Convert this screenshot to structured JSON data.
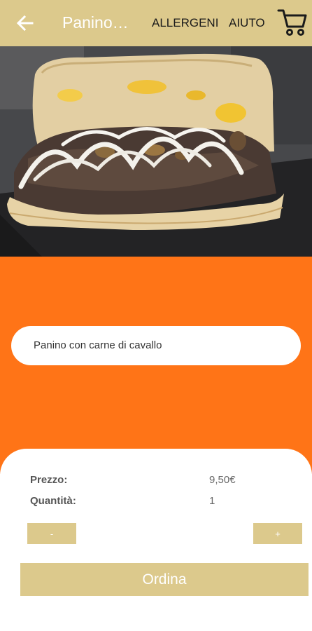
{
  "appbar": {
    "title": "Panino…",
    "allergens_label": "ALLERGENI",
    "help_label": "AIUTO",
    "back_icon": "back-arrow-icon",
    "cart_icon": "cart-icon",
    "background_color": "#dcc98c"
  },
  "product": {
    "image_description": "panino con carne e salsa",
    "description": "Panino con carne di cavallo"
  },
  "details": {
    "price_label": "Prezzo:",
    "price_value": "9,50€",
    "quantity_label": "Quantità:",
    "quantity_value": "1",
    "decrement_label": "-",
    "increment_label": "+",
    "order_label": "Ordina"
  },
  "colors": {
    "accent_orange": "#ff7417",
    "gold": "#dcc98c"
  }
}
